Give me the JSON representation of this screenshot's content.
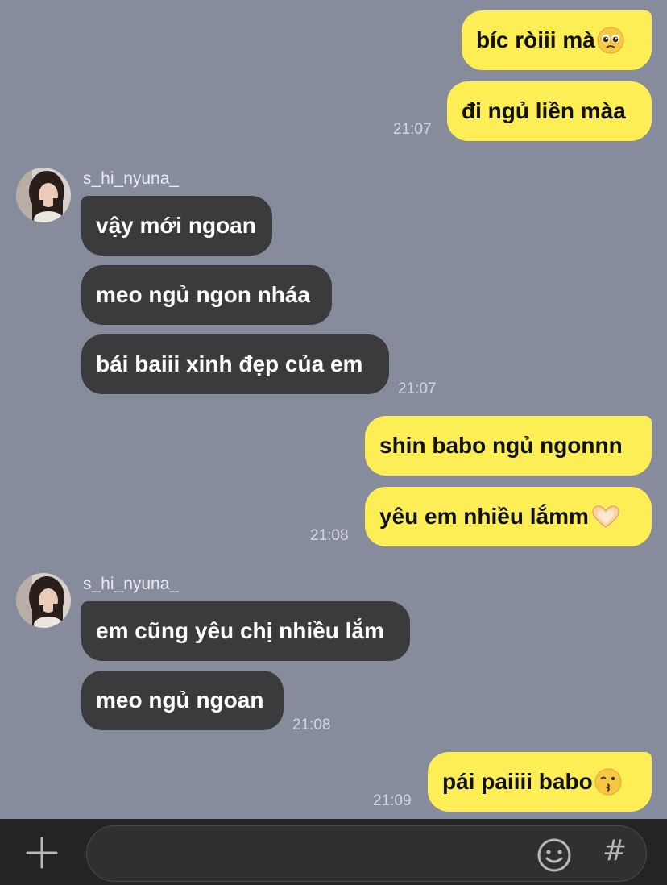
{
  "messages": {
    "m1": "bíc ròiii mà",
    "m2": "đi ngủ liền màa",
    "m3": "vậy mới ngoan",
    "m4": "meo ngủ ngon nháa",
    "m5": "bái baiii xinh đẹp của em",
    "m6": "shin babo ngủ ngonnn",
    "m7": "yêu em nhiều lắmm",
    "m8": "em cũng yêu chị nhiều lắm",
    "m9": "meo ngủ ngoan",
    "m10": "pái paiiii babo"
  },
  "times": {
    "t1": "21:07",
    "t2": "21:07",
    "t3": "21:08",
    "t4": "21:08",
    "t5": "21:09"
  },
  "sender": {
    "name": "s_hi_nyuna_"
  },
  "input_bar": {
    "placeholder": "",
    "hash_label": "#"
  },
  "icons": {
    "pleading": "pleading-face-emoji",
    "heart_hands": "heart-hands-emoji",
    "kiss": "kissing-face-emoji",
    "plus": "plus-icon",
    "smile": "emoji-icon"
  },
  "colors": {
    "background": "#868c9b",
    "outgoing_bubble": "#fdee55",
    "incoming_bubble": "#3b3b3d"
  }
}
